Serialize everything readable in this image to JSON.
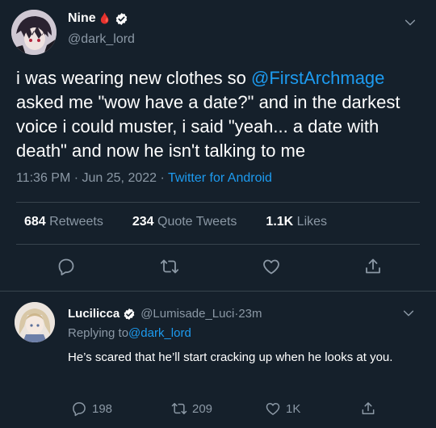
{
  "tweet": {
    "author_name": "Nine",
    "author_emoji": "🩸",
    "author_handle": "@dark_lord",
    "text_before_mention": "i was wearing new clothes so ",
    "mention": "@FirstArchmage",
    "text_after_mention": " asked me \"wow have a date?\" and in the darkest voice i could muster, i said \"yeah... a date with death\" and now he isn't talking to me",
    "time": "11:36 PM",
    "sep1": " · ",
    "date": "Jun 25, 2022",
    "sep2": " · ",
    "client": "Twitter for Android",
    "retweets_count": "684",
    "retweets_label": " Retweets",
    "quotes_count": "234",
    "quotes_label": " Quote Tweets",
    "likes_count": "1.1K",
    "likes_label": " Likes"
  },
  "reply": {
    "author_name": "Lucilicca",
    "author_handle": "@Lumisade_Luci",
    "sep": " · ",
    "age": "23m",
    "replying_prefix": "Replying to ",
    "replying_to": "@dark_lord",
    "text": "He’s scared that he’ll start cracking up when he looks at you.",
    "reply_count": "198",
    "retweet_count": "209",
    "like_count": "1K"
  },
  "colors": {
    "background": "#15202b",
    "accent": "#1d9bf0",
    "muted": "#8b98a5",
    "divider": "#38444d"
  },
  "icons": [
    "verified-badge-icon",
    "chevron-down-icon",
    "reply-icon",
    "retweet-icon",
    "like-icon",
    "share-icon"
  ]
}
